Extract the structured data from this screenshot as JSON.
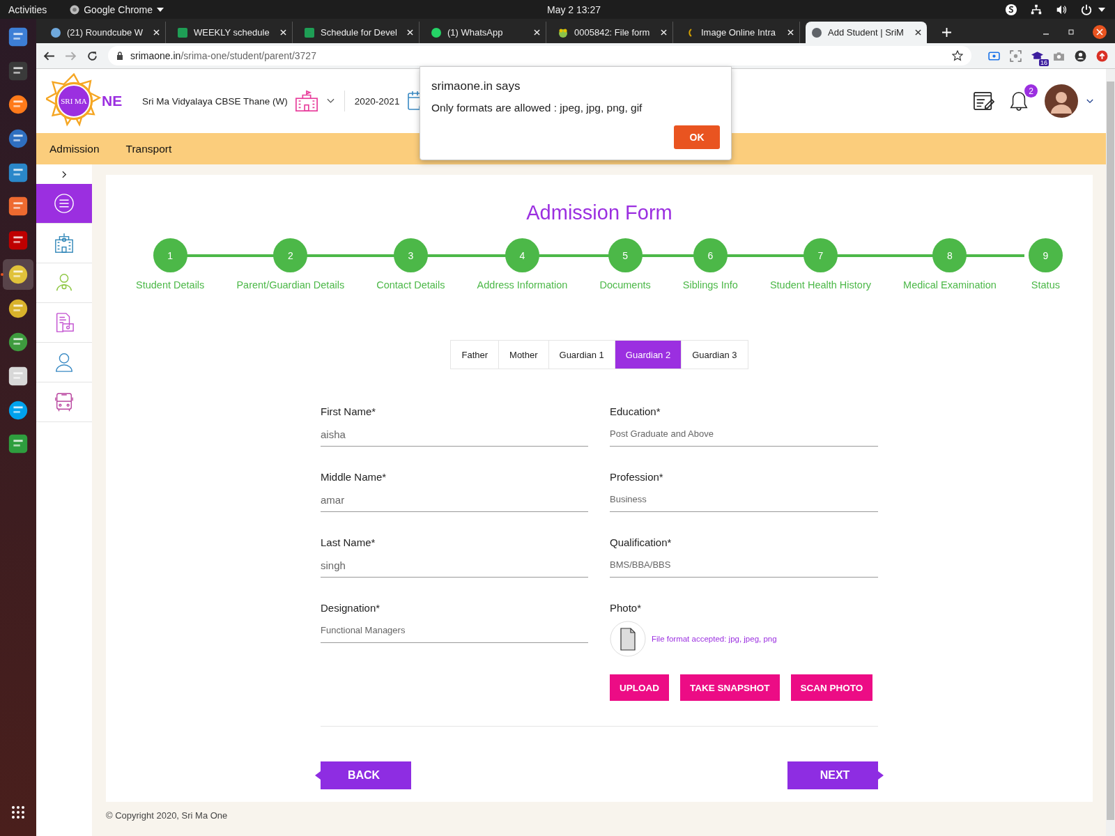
{
  "system_bar": {
    "activities": "Activities",
    "app_name": "Google Chrome",
    "clock": "May 2  13:27"
  },
  "dock": [
    {
      "kind": "files",
      "active": false
    },
    {
      "kind": "terminal",
      "active": false
    },
    {
      "kind": "firefox",
      "active": false
    },
    {
      "kind": "mail",
      "active": false
    },
    {
      "kind": "writer",
      "active": false
    },
    {
      "kind": "store",
      "active": false
    },
    {
      "kind": "ftp",
      "active": false
    },
    {
      "kind": "chrome",
      "active": true
    },
    {
      "kind": "teapot",
      "active": false
    },
    {
      "kind": "hs",
      "active": false
    },
    {
      "kind": "search",
      "active": false
    },
    {
      "kind": "skype",
      "active": false
    },
    {
      "kind": "calc",
      "active": false
    }
  ],
  "browser": {
    "tabs": [
      {
        "title": "(21) Roundcube W",
        "kind": "cube",
        "selected": false
      },
      {
        "title": "WEEKLY schedule",
        "kind": "sheet",
        "selected": false
      },
      {
        "title": "Schedule for Devel",
        "kind": "sheet",
        "selected": false
      },
      {
        "title": "(1) WhatsApp",
        "kind": "chat",
        "selected": false
      },
      {
        "title": "0005842: File form",
        "kind": "bug",
        "selected": false
      },
      {
        "title": "Image Online Intra",
        "kind": "loading",
        "selected": false
      },
      {
        "title": "Add Student | SriM",
        "kind": "globe",
        "selected": true
      }
    ],
    "url": {
      "domain": "srimaone.in",
      "path": "/srima-one/student/parent/3727"
    },
    "extension_badge": "16"
  },
  "header": {
    "logo_inner": "SRI MA",
    "logo_suffix": "NE",
    "school": "Sri Ma Vidyalaya CBSE Thane (W)",
    "year": "2020-2021",
    "notification_count": "2"
  },
  "nav": [
    "Admission",
    "Transport"
  ],
  "sidebar": [
    {
      "kind": "menu",
      "selected": true
    },
    {
      "kind": "school",
      "selected": false
    },
    {
      "kind": "staff",
      "selected": false
    },
    {
      "kind": "fees",
      "selected": false
    },
    {
      "kind": "person",
      "selected": false
    },
    {
      "kind": "bus",
      "selected": false
    }
  ],
  "form": {
    "title": "Admission Form",
    "steps": [
      {
        "number": "1",
        "label": "Student Details"
      },
      {
        "number": "2",
        "label": "Parent/Guardian Details"
      },
      {
        "number": "3",
        "label": "Contact Details"
      },
      {
        "number": "4",
        "label": "Address Information"
      },
      {
        "number": "5",
        "label": "Documents"
      },
      {
        "number": "6",
        "label": "Siblings Info"
      },
      {
        "number": "7",
        "label": "Student Health History"
      },
      {
        "number": "8",
        "label": "Medical Examination"
      },
      {
        "number": "9",
        "label": "Status"
      }
    ],
    "tabs": [
      {
        "label": "Father",
        "selected": false
      },
      {
        "label": "Mother",
        "selected": false
      },
      {
        "label": "Guardian 1",
        "selected": false
      },
      {
        "label": "Guardian 2",
        "selected": true
      },
      {
        "label": "Guardian 3",
        "selected": false
      }
    ],
    "fields_left": [
      {
        "label": "First Name*",
        "value": "aisha",
        "kind": "input"
      },
      {
        "label": "Middle Name*",
        "value": "amar",
        "kind": "input"
      },
      {
        "label": "Last Name*",
        "value": "singh",
        "kind": "input"
      },
      {
        "label": "Designation*",
        "value": "Functional Managers",
        "kind": "select"
      }
    ],
    "fields_right": [
      {
        "label": "Education*",
        "value": "Post Graduate and Above",
        "kind": "select"
      },
      {
        "label": "Profession*",
        "value": "Business",
        "kind": "select"
      },
      {
        "label": "Qualification*",
        "value": "BMS/BBA/BBS",
        "kind": "select"
      }
    ],
    "photo": {
      "label": "Photo*",
      "hint": "File format accepted: jpg, jpeg, png"
    },
    "photo_buttons": [
      "UPLOAD",
      "TAKE SNAPSHOT",
      "SCAN PHOTO"
    ],
    "back": "BACK",
    "next": "NEXT"
  },
  "footer": "© Copyright 2020, Sri Ma One",
  "dialog": {
    "title": "srimaone.in says",
    "message": "Only formats are allowed : jpeg, jpg, png, gif",
    "ok": "OK"
  }
}
